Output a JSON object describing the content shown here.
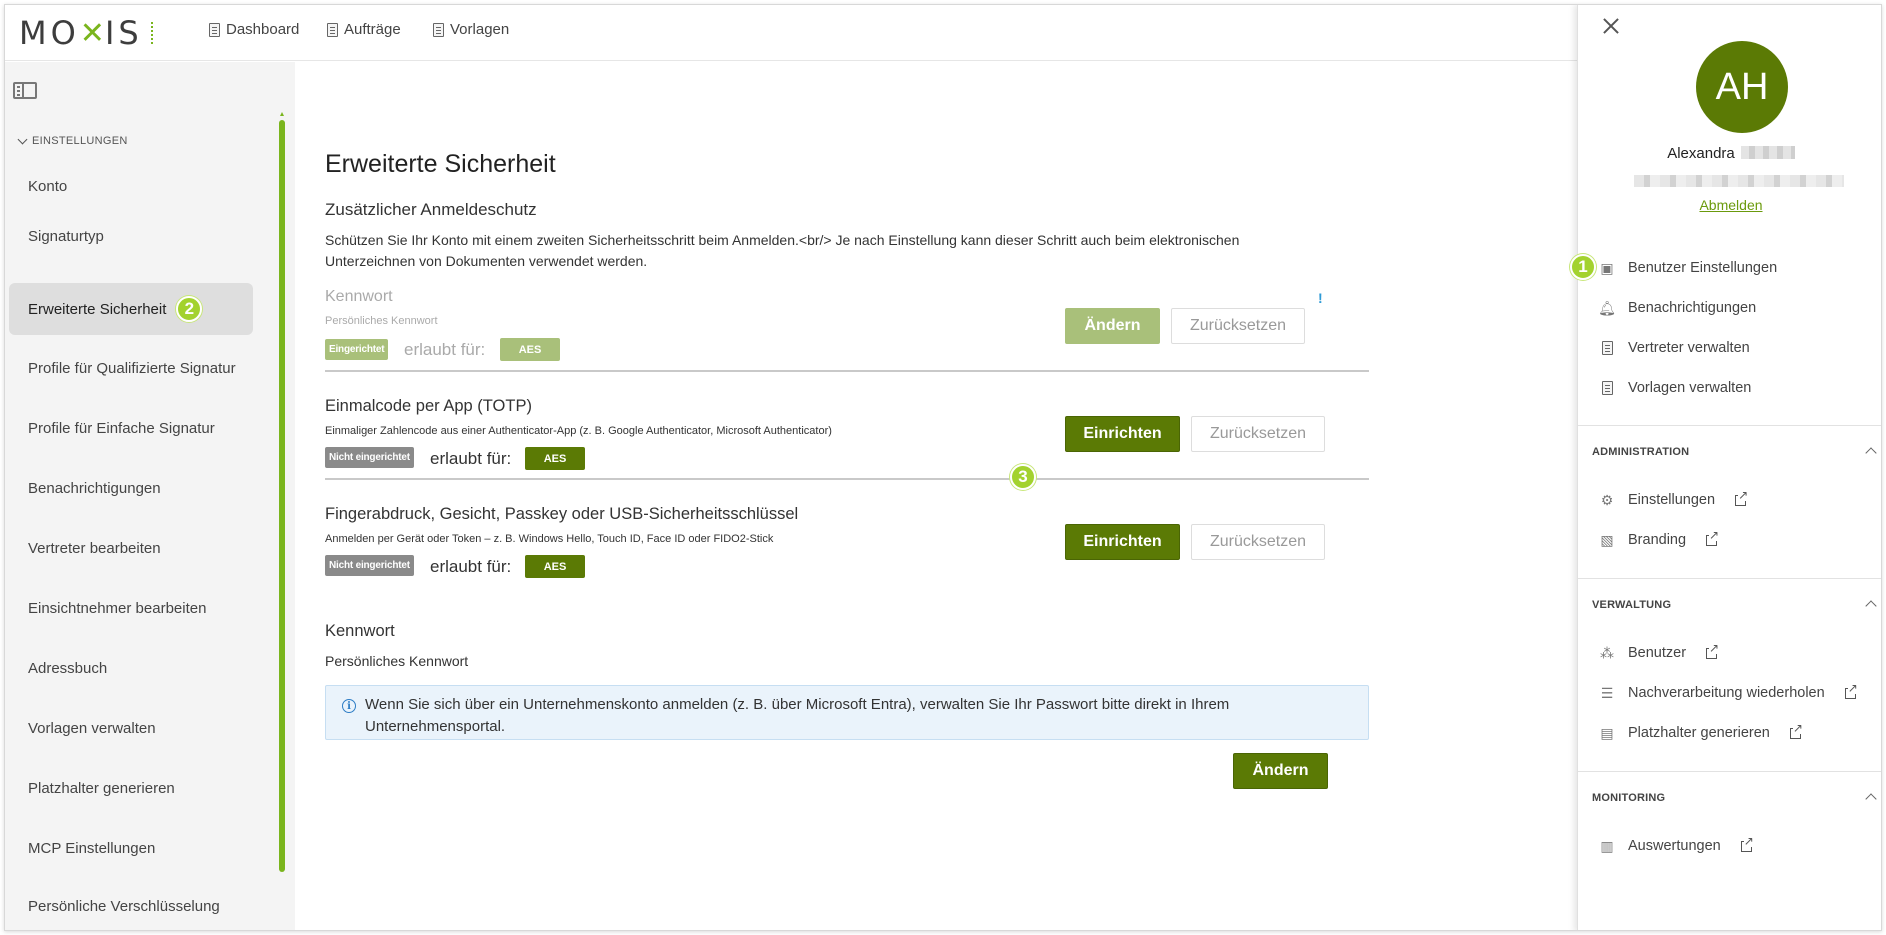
{
  "app": {
    "logo_text": "MO",
    "logo_mark": "✕",
    "logo_text2": "IS"
  },
  "topnav": [
    {
      "label": "Dashboard",
      "icon": "document-icon"
    },
    {
      "label": "Aufträge",
      "icon": "document-icon"
    },
    {
      "label": "Vorlagen",
      "icon": "document-icon"
    }
  ],
  "sidebar": {
    "section": "EINSTELLUNGEN",
    "items": [
      {
        "label": "Konto"
      },
      {
        "label": "Signaturtyp"
      },
      {
        "label": "Erweiterte Sicherheit",
        "active": true
      },
      {
        "label": "Profile für Qualifizierte Signatur"
      },
      {
        "label": "Profile für Einfache Signatur"
      },
      {
        "label": "Benachrichtigungen"
      },
      {
        "label": "Vertreter bearbeiten"
      },
      {
        "label": "Einsichtnehmer bearbeiten"
      },
      {
        "label": "Adressbuch"
      },
      {
        "label": "Vorlagen verwalten"
      },
      {
        "label": "Platzhalter generieren"
      },
      {
        "label": "MCP Einstellungen"
      },
      {
        "label": "Persönliche Verschlüsselung"
      }
    ]
  },
  "badges": {
    "one": "1",
    "two": "2",
    "three": "3"
  },
  "main": {
    "title": "Erweiterte Sicherheit",
    "subtitle": "Zusätzlicher Anmeldeschutz",
    "description": "Schützen Sie Ihr Konto mit einem zweiten Sicherheitsschritt beim Anmelden.<br/> Je nach Einstellung kann dieser Schritt auch beim elektronischen Unterzeichnen von Dokumenten verwendet werden.",
    "methods": [
      {
        "title": "Kennwort",
        "desc": "Persönliches Kennwort",
        "status": "Eingerichtet",
        "allow_label": "erlaubt für:",
        "level": "AES",
        "primary": "Ändern",
        "secondary": "Zurücksetzen",
        "info_marker": "!"
      },
      {
        "title": "Einmalcode per App (TOTP)",
        "desc": "Einmaliger Zahlencode aus einer Authenticator-App (z. B. Google Authenticator, Microsoft Authenticator)",
        "status": "Nicht eingerichtet",
        "allow_label": "erlaubt für:",
        "level": "AES",
        "primary": "Einrichten",
        "secondary": "Zurücksetzen"
      },
      {
        "title": "Fingerabdruck, Gesicht, Passkey oder USB-Sicherheitsschlüssel",
        "desc": "Anmelden per Gerät oder Token – z. B. Windows Hello, Touch ID, Face ID oder FIDO2-Stick",
        "status": "Nicht eingerichtet",
        "allow_label": "erlaubt für:",
        "level": "AES",
        "primary": "Einrichten",
        "secondary": "Zurücksetzen"
      }
    ],
    "password": {
      "title": "Kennwort",
      "desc": "Persönliches Kennwort",
      "info": "Wenn Sie sich über ein Unternehmenskonto anmelden (z. B. über Microsoft Entra), verwalten Sie Ihr Passwort bitte direkt in Ihrem Unternehmensportal.",
      "button": "Ändern"
    }
  },
  "panel": {
    "initials": "AH",
    "first_name": "Alexandra",
    "logout": "Abmelden",
    "user_items": [
      {
        "label": "Benutzer Einstellungen",
        "icon": "user-card-icon"
      },
      {
        "label": "Benachrichtigungen",
        "icon": "bell-icon"
      },
      {
        "label": "Vertreter verwalten",
        "icon": "document-icon"
      },
      {
        "label": "Vorlagen verwalten",
        "icon": "document-icon"
      }
    ],
    "sections": [
      {
        "title": "ADMINISTRATION",
        "items": [
          {
            "label": "Einstellungen",
            "icon": "gear-icon"
          },
          {
            "label": "Branding",
            "icon": "image-icon"
          }
        ]
      },
      {
        "title": "VERWALTUNG",
        "items": [
          {
            "label": "Benutzer",
            "icon": "users-icon"
          },
          {
            "label": "Nachverarbeitung wiederholen",
            "icon": "checklist-icon"
          },
          {
            "label": "Platzhalter generieren",
            "icon": "id-card-icon"
          }
        ]
      },
      {
        "title": "MONITORING",
        "items": [
          {
            "label": "Auswertungen",
            "icon": "report-icon"
          }
        ]
      }
    ]
  },
  "colors": {
    "accent": "#5b7a05",
    "accent_light": "#a3d22e",
    "brand": "#7ab51d",
    "info_bg": "#eaf3fb"
  }
}
